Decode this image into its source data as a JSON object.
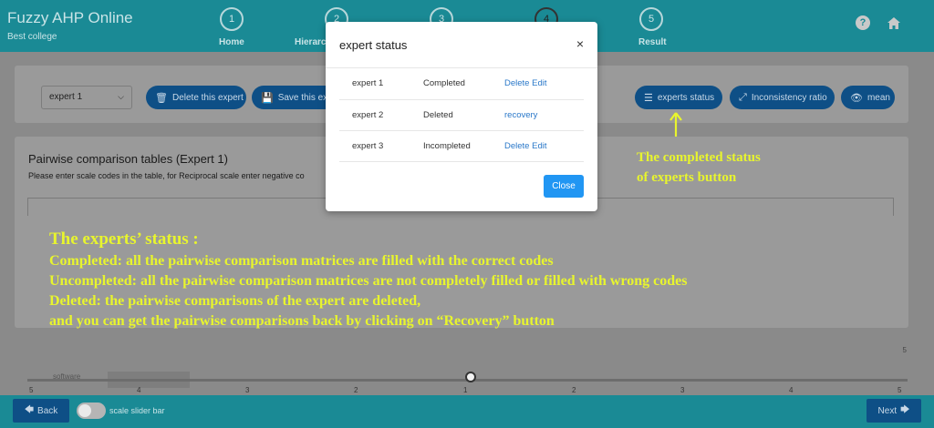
{
  "app": {
    "title": "Fuzzy AHP Online",
    "subtitle": "Best college"
  },
  "steps": [
    {
      "number": "1",
      "label": "Home"
    },
    {
      "number": "2",
      "label": "Hierarc"
    },
    {
      "number": "3",
      "label": ""
    },
    {
      "number": "4",
      "label": ""
    },
    {
      "number": "5",
      "label": "Result"
    }
  ],
  "topbar": {
    "help_icon": "question-icon",
    "home_icon": "home-icon"
  },
  "toolbar": {
    "expert_select_value": "expert 1",
    "delete_label": "Delete this expert",
    "save_label": "Save this exp",
    "experts_status_label": "experts status",
    "inconsistency_label": "Inconsistency ratio",
    "mean_label": "mean"
  },
  "content": {
    "title": "Pairwise comparison tables (Expert 1)",
    "note": "Please enter scale codes in the table, for Reciprocal scale enter negative co"
  },
  "callout": {
    "line1": "The completed status",
    "line2": "of experts button"
  },
  "info": {
    "heading": "The experts’ status :",
    "lines": [
      "Completed: all the pairwise comparison matrices are filled with the correct codes",
      "Uncompleted: all the pairwise comparison matrices are not completely filled or filled with wrong codes",
      "Deleted: the pairwise comparisons of the expert are deleted,",
      " and you can get the pairwise comparisons back  by clicking on “Recovery” button"
    ]
  },
  "slider": {
    "label": "software",
    "side_number": "5",
    "ticks": [
      "5",
      "4",
      "3",
      "2",
      "1",
      "2",
      "3",
      "4",
      "5"
    ]
  },
  "bottom": {
    "back_label": "Back",
    "next_label": "Next",
    "toggle_label": "scale slider bar"
  },
  "modal": {
    "title": "expert status",
    "close_icon": "×",
    "close_button": "Close",
    "rows": [
      {
        "name": "expert 1",
        "status": "Completed",
        "action1": "Delete",
        "action2": "Edit"
      },
      {
        "name": "expert 2",
        "status": "Deleted",
        "action1": "recovery",
        "action2": ""
      },
      {
        "name": "expert 3",
        "status": "Incompleted",
        "action1": "Delete",
        "action2": "Edit"
      }
    ]
  },
  "colors": {
    "teal": "#1a8a95",
    "button_blue": "#2196f3",
    "link_blue": "#2a78c9",
    "annotation_yellow": "#e8f52d"
  }
}
